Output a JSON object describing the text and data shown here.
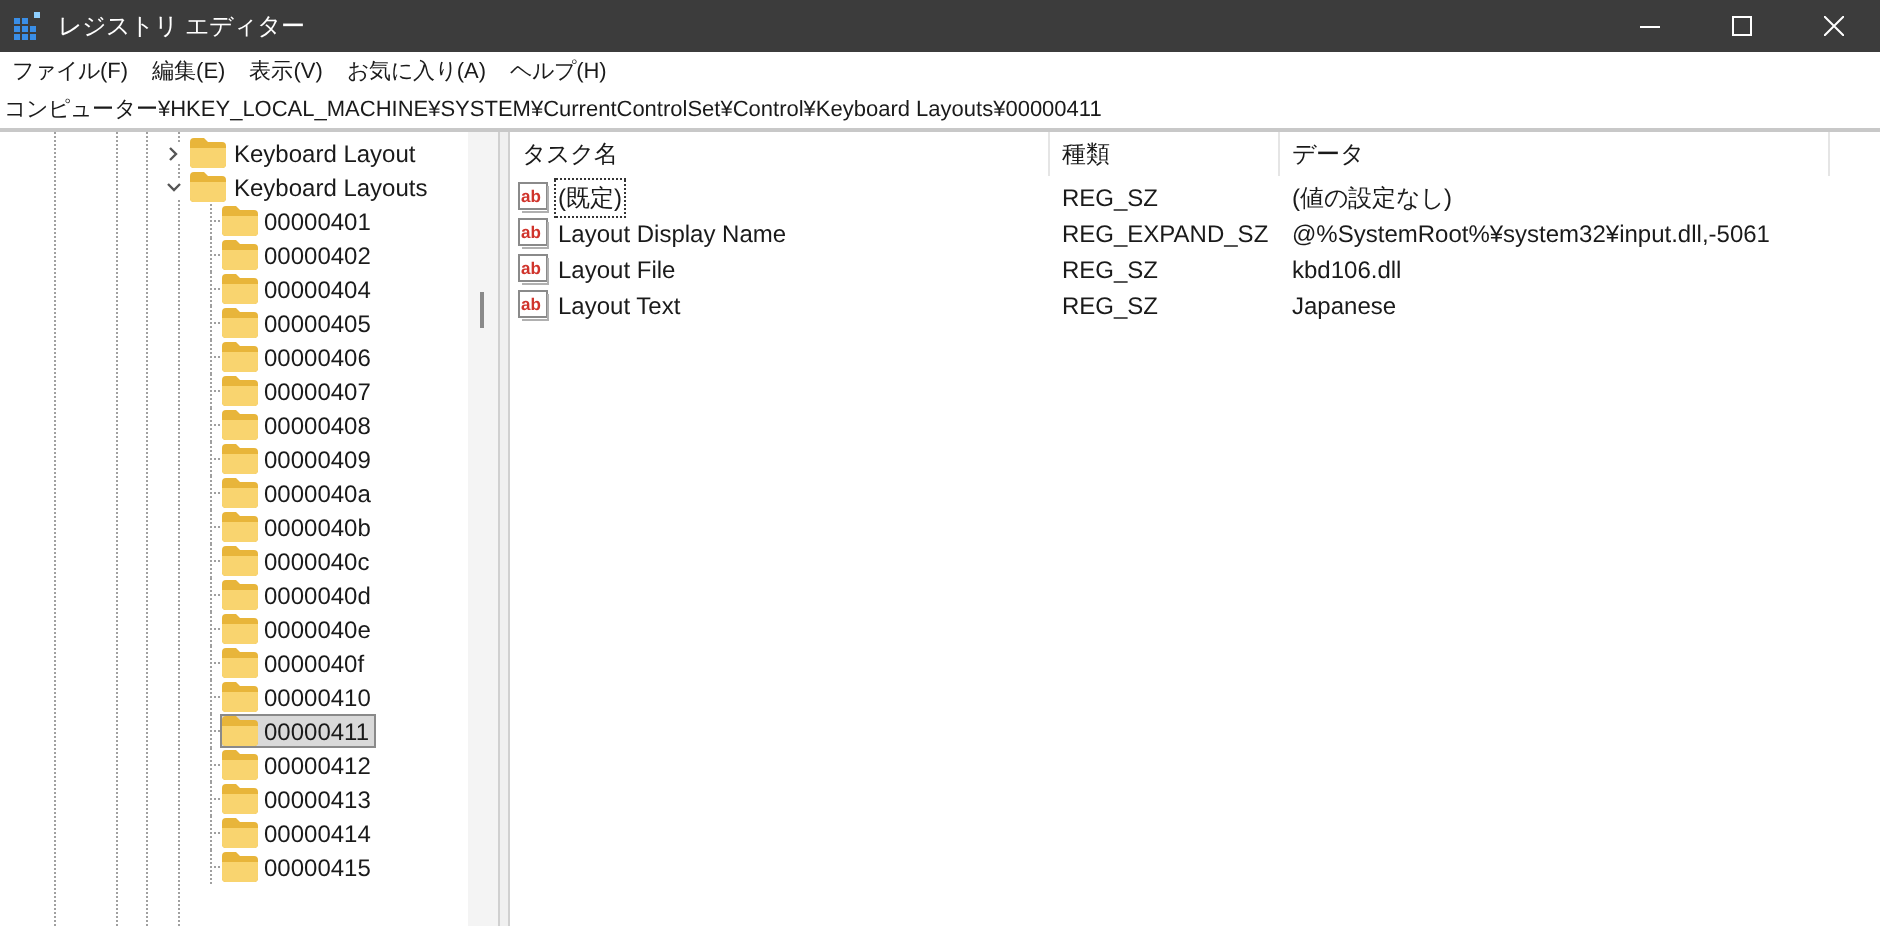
{
  "window": {
    "title": "レジストリ エディター"
  },
  "menu": [
    "ファイル(F)",
    "編集(E)",
    "表示(V)",
    "お気に入り(A)",
    "ヘルプ(H)"
  ],
  "address": "コンピューター¥HKEY_LOCAL_MACHINE¥SYSTEM¥CurrentControlSet¥Control¥Keyboard Layouts¥00000411",
  "tree": [
    {
      "label": "Keyboard Layout",
      "expanded": false,
      "selected": false
    },
    {
      "label": "Keyboard Layouts",
      "expanded": true,
      "selected": false,
      "children": [
        {
          "label": "00000401",
          "selected": false
        },
        {
          "label": "00000402",
          "selected": false
        },
        {
          "label": "00000404",
          "selected": false
        },
        {
          "label": "00000405",
          "selected": false
        },
        {
          "label": "00000406",
          "selected": false
        },
        {
          "label": "00000407",
          "selected": false
        },
        {
          "label": "00000408",
          "selected": false
        },
        {
          "label": "00000409",
          "selected": false
        },
        {
          "label": "0000040a",
          "selected": false
        },
        {
          "label": "0000040b",
          "selected": false
        },
        {
          "label": "0000040c",
          "selected": false
        },
        {
          "label": "0000040d",
          "selected": false
        },
        {
          "label": "0000040e",
          "selected": false
        },
        {
          "label": "0000040f",
          "selected": false
        },
        {
          "label": "00000410",
          "selected": false
        },
        {
          "label": "00000411",
          "selected": true
        },
        {
          "label": "00000412",
          "selected": false
        },
        {
          "label": "00000413",
          "selected": false
        },
        {
          "label": "00000414",
          "selected": false
        },
        {
          "label": "00000415",
          "selected": false
        }
      ]
    }
  ],
  "table": {
    "columns": [
      "タスク名",
      "種類",
      "データ"
    ],
    "rows": [
      {
        "icon": "ab",
        "name": "(既定)",
        "type": "REG_SZ",
        "data": "(値の設定なし)",
        "focused": true
      },
      {
        "icon": "ab",
        "name": "Layout Display Name",
        "type": "REG_EXPAND_SZ",
        "data": "@%SystemRoot%¥system32¥input.dll,-5061",
        "focused": false
      },
      {
        "icon": "ab",
        "name": "Layout File",
        "type": "REG_SZ",
        "data": "kbd106.dll",
        "focused": false
      },
      {
        "icon": "ab",
        "name": "Layout Text",
        "type": "REG_SZ",
        "data": "Japanese",
        "focused": false
      }
    ]
  }
}
